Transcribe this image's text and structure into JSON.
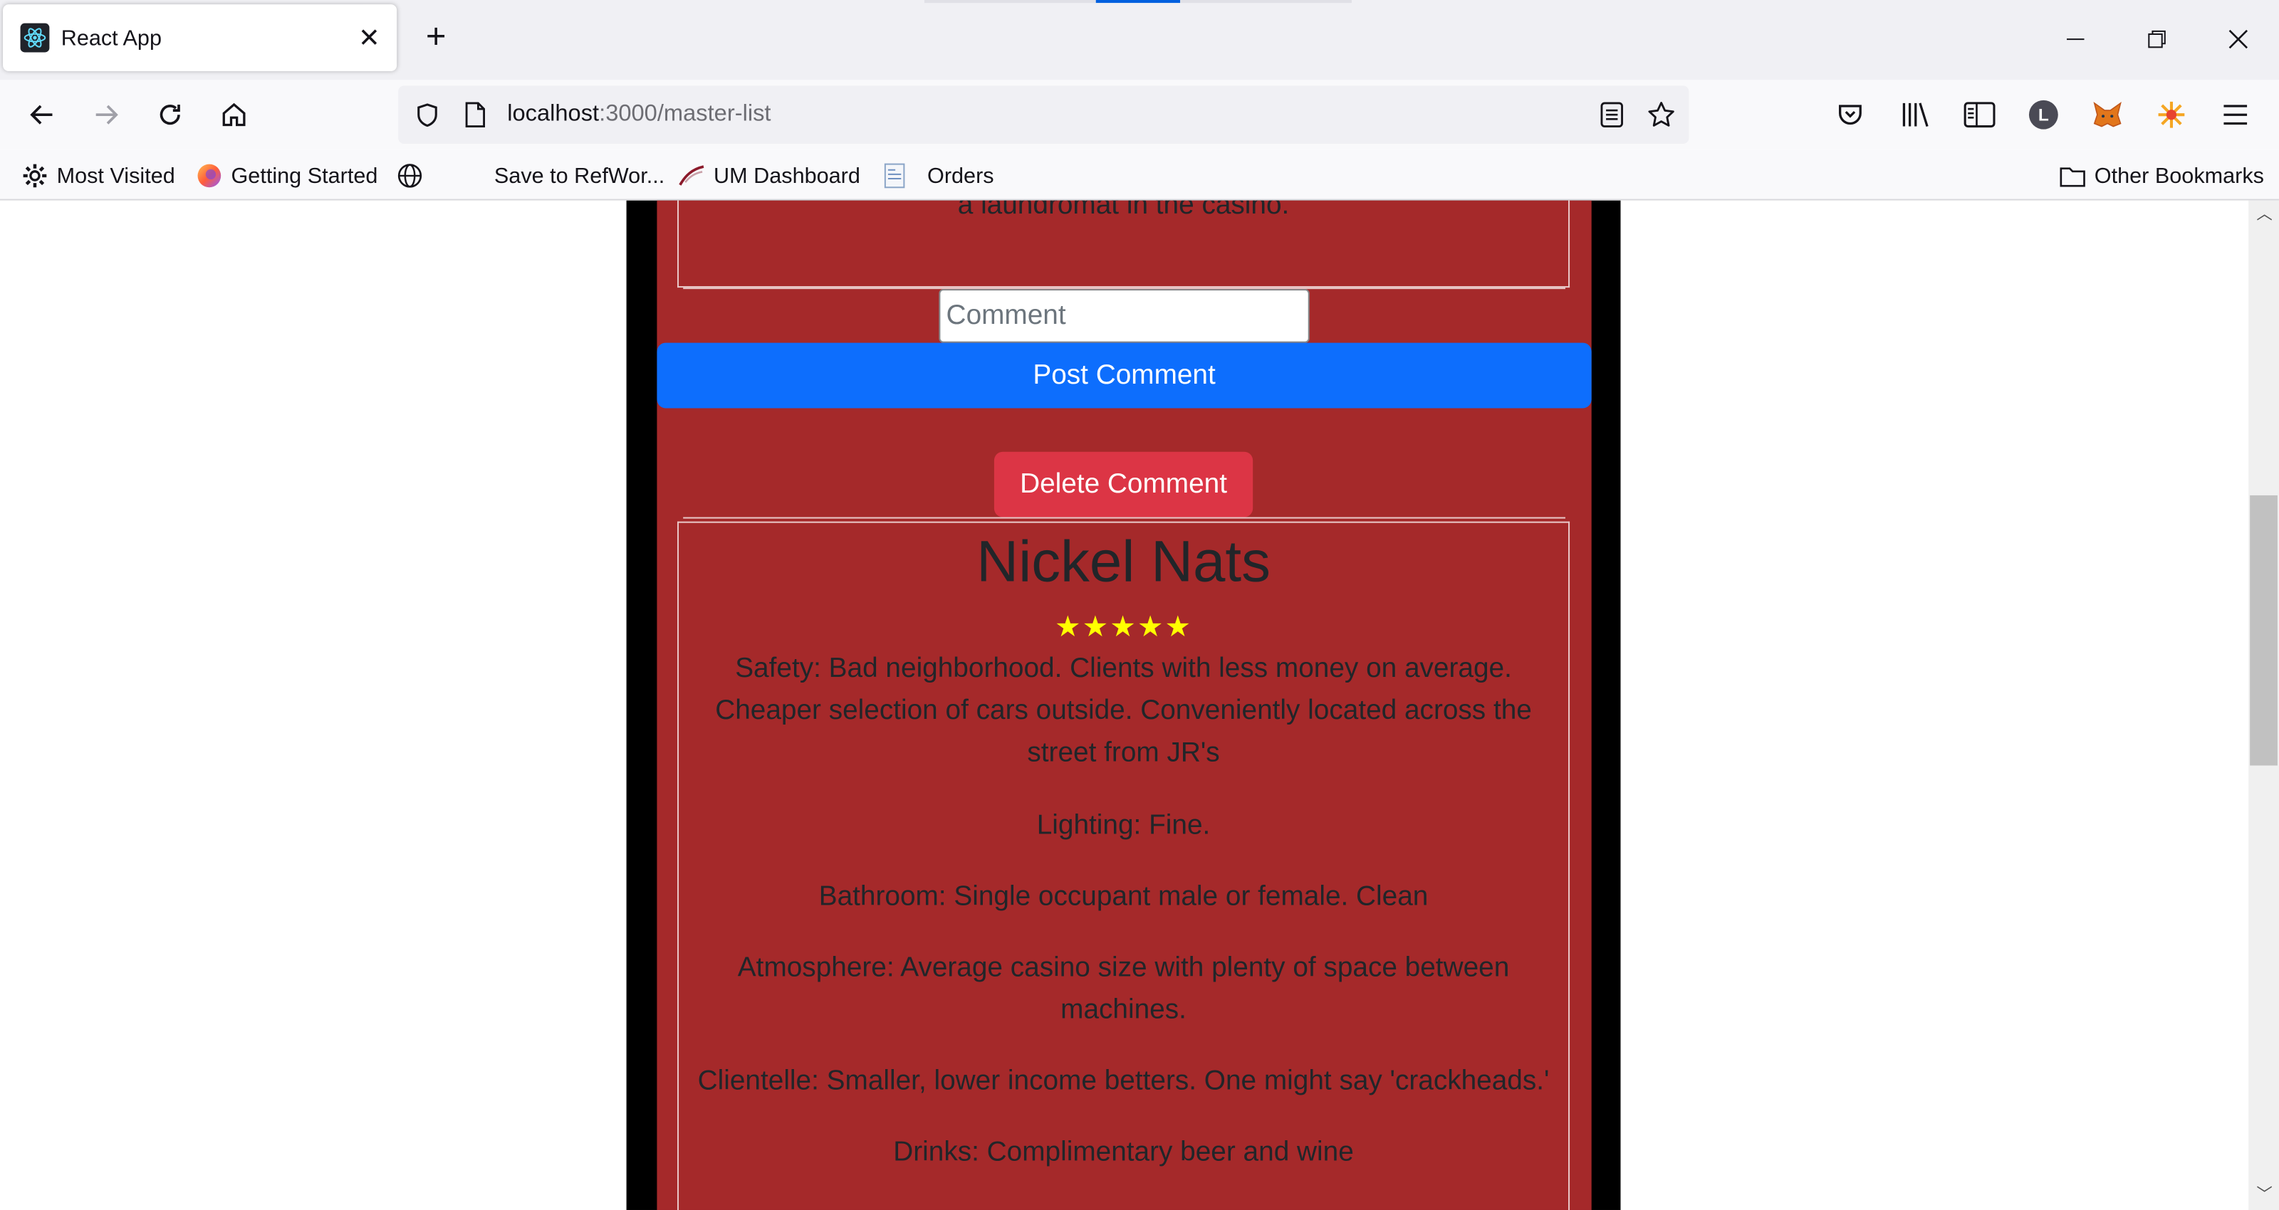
{
  "browser": {
    "tab_title": "React App",
    "url_host": "localhost",
    "url_path": ":3000/master-list",
    "bookmarks": [
      {
        "label": "Most Visited",
        "icon": "gear-icon"
      },
      {
        "label": "Getting Started",
        "icon": "firefox-icon"
      },
      {
        "label": "",
        "icon": "globe-icon"
      },
      {
        "label": "Save to RefWor...",
        "icon": "blank-icon"
      },
      {
        "label": "UM Dashboard",
        "icon": "um-logo-icon"
      },
      {
        "label": "Orders",
        "icon": "document-icon"
      }
    ],
    "other_bookmarks": "Other Bookmarks",
    "profile_initial": "L"
  },
  "page": {
    "previous_review_text": "neighborhood, the cars outside are often dilapidated. BONUS: there is a laundromat in the casino.",
    "comment_placeholder": "Comment",
    "post_comment_label": "Post Comment",
    "delete_comment_label": "Delete Comment",
    "review": {
      "title": "Nickel Nats",
      "rating": 5,
      "stars": "★★★★★",
      "paragraphs": [
        "Safety: Bad neighborhood. Clients with less money on average. Cheaper selection of cars outside. Conveniently located across the street from JR's",
        "Lighting: Fine.",
        "Bathroom: Single occupant male or female. Clean",
        "Atmosphere: Average casino size with plenty of space between machines.",
        "Clientelle: Smaller, lower income betters. One might say 'crackheads.'",
        "Drinks: Complimentary beer and wine"
      ]
    }
  },
  "colors": {
    "page_bg": "#a5292a",
    "post_button": "#0d6efd",
    "delete_button": "#dc3545",
    "stars": "#ffff00"
  }
}
